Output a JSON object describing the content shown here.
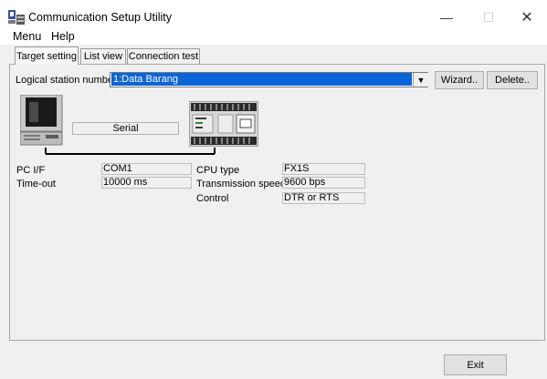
{
  "window": {
    "title": "Communication Setup Utility",
    "minimize_glyph": "—",
    "maximize_glyph": "☐",
    "close_glyph": "✕"
  },
  "menu": {
    "items": [
      {
        "label": "Menu"
      },
      {
        "label": "Help"
      }
    ]
  },
  "tabs": [
    {
      "label": "Target setting",
      "active": true
    },
    {
      "label": "List view",
      "active": false
    },
    {
      "label": "Connection test",
      "active": false
    }
  ],
  "station": {
    "label": "Logical station number",
    "selected": "1:Data Barang",
    "arrow_glyph": "▼",
    "wizard_label": "Wizard..",
    "delete_label": "Delete.."
  },
  "diagram": {
    "connection_label": "Serial"
  },
  "settings": {
    "pc_if_label": "PC I/F",
    "pc_if_value": "COM1",
    "timeout_label": "Time-out",
    "timeout_value": "10000 ms",
    "cpu_type_label": "CPU type",
    "cpu_type_value": "FX1S",
    "transmission_speed_label": "Transmission speed",
    "transmission_speed_value": "9600 bps",
    "control_label": "Control",
    "control_value": "DTR or RTS"
  },
  "footer": {
    "exit_label": "Exit"
  },
  "icons": {
    "app": "app-icon",
    "pc": "pc-icon",
    "plc": "plc-icon"
  },
  "colors": {
    "selection": "#0a64d8",
    "window_bg": "#f0f0f0"
  }
}
